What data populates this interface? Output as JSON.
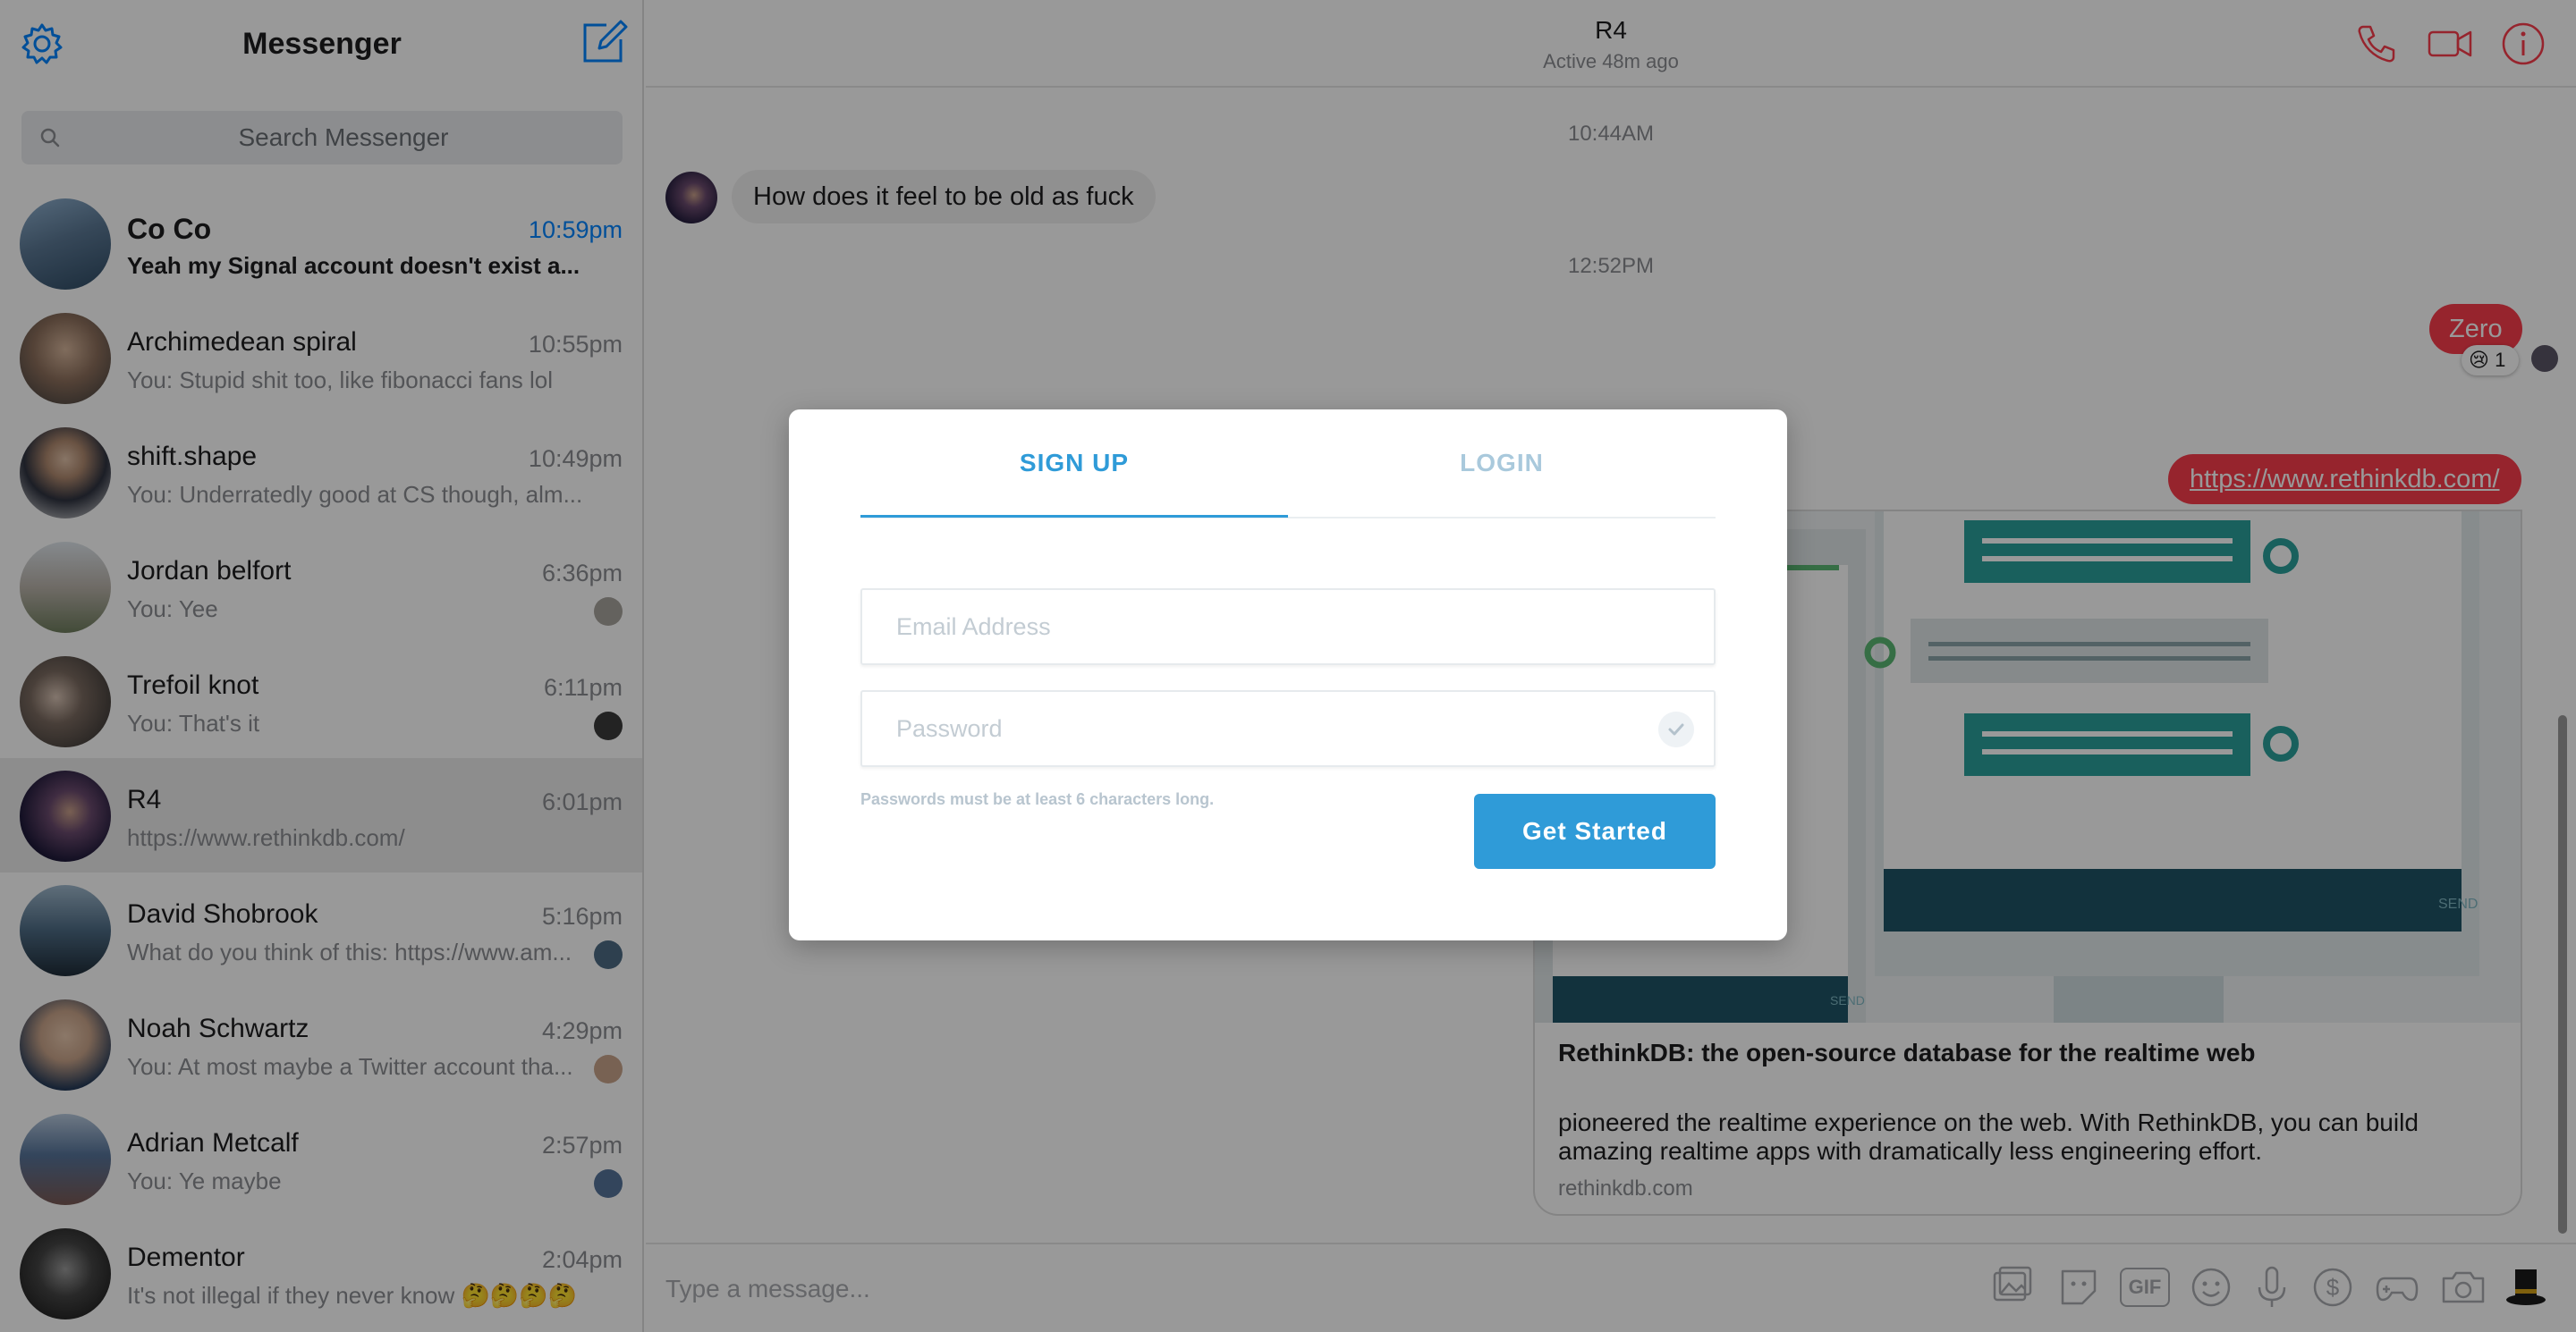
{
  "sidebar": {
    "title": "Messenger",
    "search_placeholder": "Search Messenger",
    "conversations": [
      {
        "name": "Co Co",
        "time": "10:59pm",
        "snippet": "Yeah my Signal account doesn't exist a...",
        "unread": true,
        "avatar_color": "#5b7894"
      },
      {
        "name": "Archimedean spiral",
        "time": "10:55pm",
        "snippet": "You: Stupid shit too, like fibonacci fans lol",
        "avatar_color": "#6e5a4e"
      },
      {
        "name": "shift.shape",
        "time": "10:49pm",
        "snippet": "You: Underratedly good at CS though, alm...",
        "avatar_color": "#2f3340"
      },
      {
        "name": "Jordan belfort",
        "time": "6:36pm",
        "snippet": "You: Yee",
        "avatar_color": "#a7a39d"
      },
      {
        "name": "Trefoil knot",
        "time": "6:11pm",
        "snippet": "You: That's it",
        "avatar_color": "#3b3b3b"
      },
      {
        "name": "R4",
        "time": "6:01pm",
        "snippet": "https://www.rethinkdb.com/",
        "active": true,
        "avatar_color": "#3c2a4e"
      },
      {
        "name": "David Shobrook",
        "time": "5:16pm",
        "snippet": "What do you think of this: https://www.am...",
        "avatar_color": "#4d6b84"
      },
      {
        "name": "Noah Schwartz",
        "time": "4:29pm",
        "snippet": "You: At most maybe a Twitter account tha...",
        "avatar_color": "#c9a48a"
      },
      {
        "name": "Adrian Metcalf",
        "time": "2:57pm",
        "snippet": "You: Ye maybe",
        "avatar_color": "#56749a"
      },
      {
        "name": "Dementor",
        "time": "2:04pm",
        "snippet": "It's not illegal if they never know 🤔🤔🤔🤔",
        "avatar_color": "#222222"
      }
    ]
  },
  "chat": {
    "name": "R4",
    "status": "Active 48m ago",
    "time_1": "10:44AM",
    "incoming_message": "How does it feel to be old as fuck",
    "time_2": "12:52PM",
    "outgoing_1": "Zero",
    "reaction_emoji": "😢",
    "reaction_count": "1",
    "outgoing_link": "https://www.rethinkdb.com/",
    "link_card": {
      "title": "RethinkDB: the open-source database for the realtime web",
      "description": "pioneered the realtime experience on the web. With RethinkDB, you can build amazing realtime apps with dramatically less engineering effort.",
      "domain": "rethinkdb.com",
      "send_label_1": "SEND",
      "send_label_2": "SEND"
    },
    "composer_placeholder": "Type a message...",
    "gif_label": "GIF"
  },
  "modal": {
    "tab_signup": "SIGN UP",
    "tab_login": "LOGIN",
    "email_placeholder": "Email Address",
    "password_placeholder": "Password",
    "hint": "Passwords must be at least 6 characters long.",
    "button": "Get Started"
  },
  "colors": {
    "messenger_blue": "#0084ff",
    "outgoing_bubble": "#fa3c4c",
    "modal_accent": "#2f9bd8"
  }
}
